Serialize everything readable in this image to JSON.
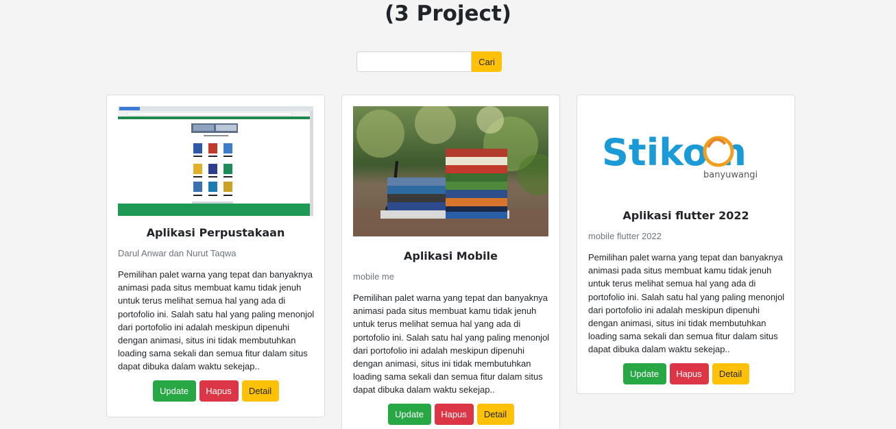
{
  "page": {
    "title": "(3 Project)"
  },
  "search": {
    "placeholder": "",
    "value": "",
    "button_label": "Cari"
  },
  "colors": {
    "update": "#28a745",
    "hapus": "#dc3545",
    "detail": "#ffc107",
    "cari": "#ffc107"
  },
  "cards": [
    {
      "image": "library-website-screenshot",
      "title": "Aplikasi Perpustakaan",
      "subtitle": "Darul Anwar dan Nurut Taqwa",
      "description": "Pemilihan palet warna yang tepat dan banyaknya animasi pada situs membuat kamu tidak jenuh untuk terus melihat semua hal yang ada di portofolio ini. Salah satu hal yang paling menonjol dari portofolio ini adalah meskipun dipenuhi dengan animasi, situs ini tidak membutuhkan loading sama sekali dan semua fitur dalam situs dapat dibuka dalam waktu sekejap..",
      "buttons": {
        "update": "Update",
        "hapus": "Hapus",
        "detail": "Detail"
      }
    },
    {
      "image": "book-stack-photo",
      "title": "Aplikasi Mobile",
      "subtitle": "mobile me",
      "description": "Pemilihan palet warna yang tepat dan banyaknya animasi pada situs membuat kamu tidak jenuh untuk terus melihat semua hal yang ada di portofolio ini. Salah satu hal yang paling menonjol dari portofolio ini adalah meskipun dipenuhi dengan animasi, situs ini tidak membutuhkan loading sama sekali dan semua fitur dalam situs dapat dibuka dalam waktu sekejap..",
      "buttons": {
        "update": "Update",
        "hapus": "Hapus",
        "detail": "Detail"
      }
    },
    {
      "image": "stikom-logo",
      "logo_text": "Stikom",
      "logo_subtext": "banyuwangi",
      "title": "Aplikasi flutter 2022",
      "subtitle": "mobile flutter 2022",
      "description": "Pemilihan palet warna yang tepat dan banyaknya animasi pada situs membuat kamu tidak jenuh untuk terus melihat semua hal yang ada di portofolio ini. Salah satu hal yang paling menonjol dari portofolio ini adalah meskipun dipenuhi dengan animasi, situs ini tidak membutuhkan loading sama sekali dan semua fitur dalam situs dapat dibuka dalam waktu sekejap..",
      "buttons": {
        "update": "Update",
        "hapus": "Hapus",
        "detail": "Detail"
      }
    }
  ]
}
